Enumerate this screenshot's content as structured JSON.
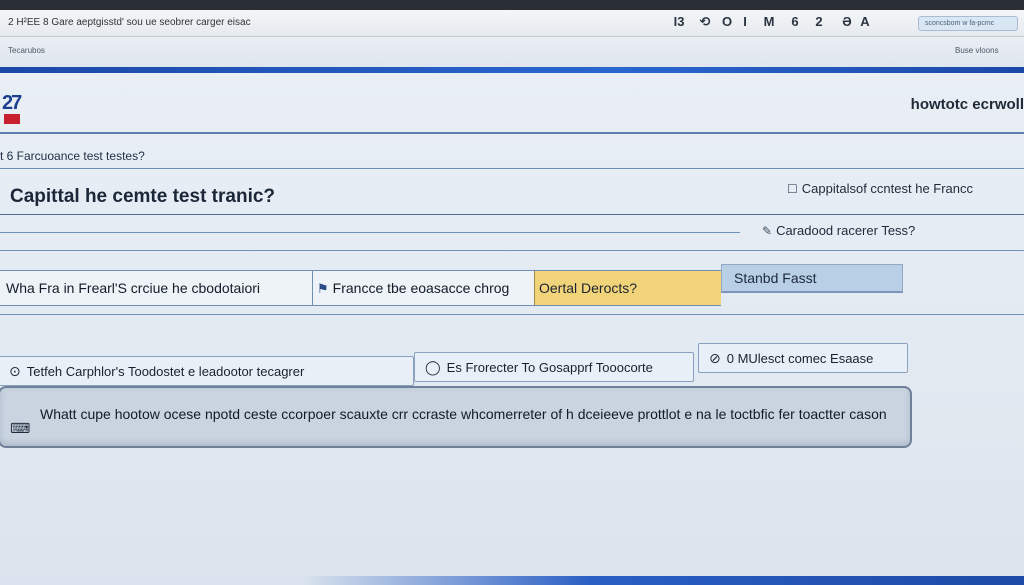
{
  "titlebar": {
    "left_text": "2   H²EE   8   Gare aeptgisstd' sou ue seobrer carger eisac",
    "tools": [
      "I3",
      "⟲",
      "O",
      "I",
      "M",
      "6",
      "2",
      "Ə",
      "A"
    ],
    "address": "sconcsbom w fa-pcmc"
  },
  "subbar": {
    "left_text": "Tecarubos",
    "right_text": "Buse vloons"
  },
  "brand": "howtotc ecrwoll",
  "breadcrumb": "t 6 Farcuoance test testes?",
  "question_title": "Capittal he cemte test tranic?",
  "side_link_1": "Cappitalsof ccntest he Francc",
  "side_link_2": "Caradood racerer Tess?",
  "row": {
    "cell_a": "Wha Fra in Frearl'S crciue he cbodotaiori",
    "cell_b": "Francce tbe eoasacce chrog",
    "cell_c": "Oertal Derocts?",
    "standard_button": "Stanbd Fasst"
  },
  "options": [
    "Tetfeh Carphlor's Toodostet e leadootor tecagrer",
    "Es Frorecter To Gosapprf Tooocorte",
    "0 MUlesct comec Esaase"
  ],
  "answer_text": "Whatt cupe hootow ocese npotd ceste ccorpoer scauxte crr ccraste whcomerreter of h dceieeve prottlot e na le toctbfic fer toactter cason",
  "colors": {
    "accent_blue": "#1a49a8",
    "highlight_yellow": "#f1d37a",
    "button_blue": "#b9cfe6"
  }
}
